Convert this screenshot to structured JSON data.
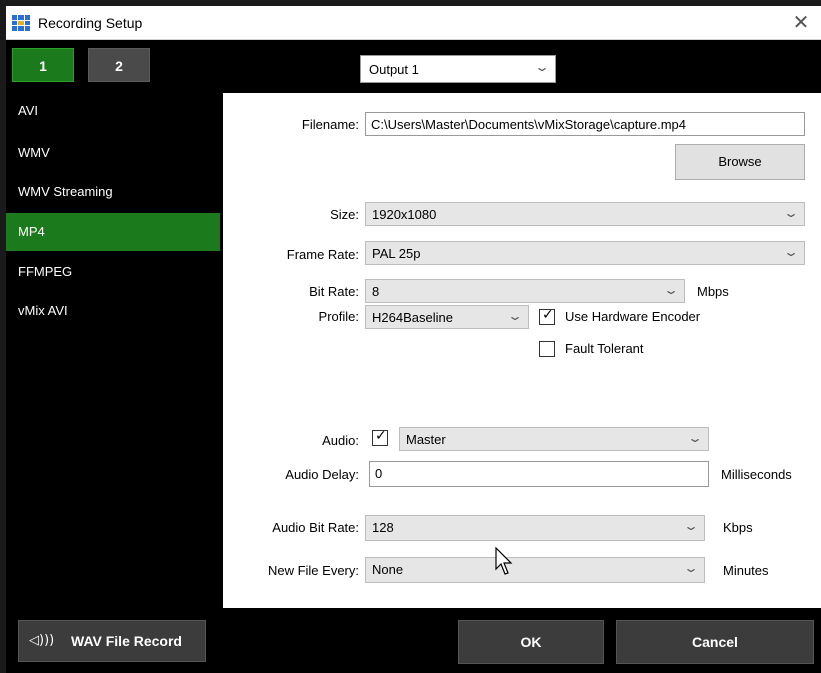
{
  "window": {
    "title": "Recording Setup",
    "close_glyph": "✕"
  },
  "tabs": [
    {
      "label": "1"
    },
    {
      "label": "2"
    }
  ],
  "output_select": {
    "value": "Output 1"
  },
  "sidebar": {
    "items": [
      {
        "label": "AVI"
      },
      {
        "label": "WMV"
      },
      {
        "label": "WMV Streaming"
      },
      {
        "label": "MP4"
      },
      {
        "label": "FFMPEG"
      },
      {
        "label": "vMix AVI"
      }
    ],
    "active_index": 3
  },
  "form": {
    "filename_label": "Filename:",
    "filename_value": "C:\\Users\\Master\\Documents\\vMixStorage\\capture.mp4",
    "browse_label": "Browse",
    "size_label": "Size:",
    "size_value": "1920x1080",
    "frame_rate_label": "Frame Rate:",
    "frame_rate_value": "PAL 25p",
    "bit_rate_label": "Bit Rate:",
    "bit_rate_value": "8",
    "bit_rate_unit": "Mbps",
    "profile_label": "Profile:",
    "profile_value": "H264Baseline",
    "hw_encoder_label": "Use Hardware Encoder",
    "hw_encoder_checked": true,
    "fault_tolerant_label": "Fault Tolerant",
    "fault_tolerant_checked": false,
    "audio_label": "Audio:",
    "audio_checked": true,
    "audio_value": "Master",
    "audio_delay_label": "Audio Delay:",
    "audio_delay_value": "0",
    "audio_delay_unit": "Milliseconds",
    "audio_bitrate_label": "Audio Bit Rate:",
    "audio_bitrate_value": "128",
    "audio_bitrate_unit": "Kbps",
    "new_file_label": "New File Every:",
    "new_file_value": "None",
    "new_file_unit": "Minutes"
  },
  "footer": {
    "wav_label": "WAV File Record",
    "wav_icon": "speaker-icon",
    "ok_label": "OK",
    "cancel_label": "Cancel"
  },
  "colors": {
    "accent": "#1b7a1b",
    "background": "#000000",
    "panel": "#ffffff"
  }
}
